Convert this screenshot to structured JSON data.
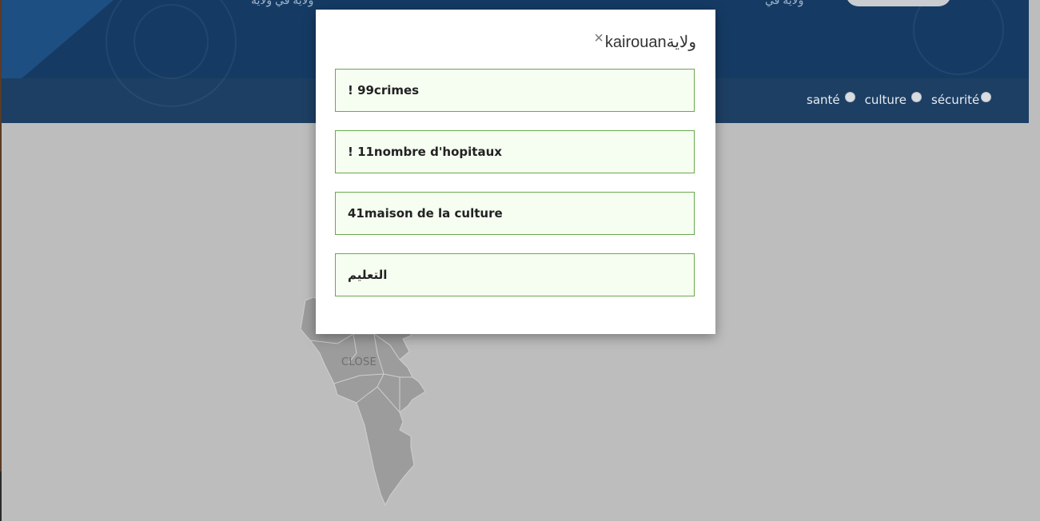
{
  "header": {
    "partial_text_left": "ولاية في ولاية",
    "partial_text_right": "ولاية في"
  },
  "filters": {
    "items": [
      {
        "label": "santé"
      },
      {
        "label": "culture"
      },
      {
        "label": "sécurité"
      }
    ]
  },
  "map": {
    "close_label": "CLOSE"
  },
  "modal": {
    "title": "kairouanولاية",
    "close_glyph": "×",
    "cards": [
      {
        "text": "! 99crimes"
      },
      {
        "text": "! 11nombre d'hopitaux"
      },
      {
        "text": "41maison de la culture"
      },
      {
        "text": "التعليم"
      }
    ]
  },
  "colors": {
    "header_blue": "#153b64",
    "nav_blue": "#1d3f63",
    "overlay_grey": "#bdbdbd",
    "card_border": "#6aa84f",
    "card_bg": "#f6fdf1"
  }
}
